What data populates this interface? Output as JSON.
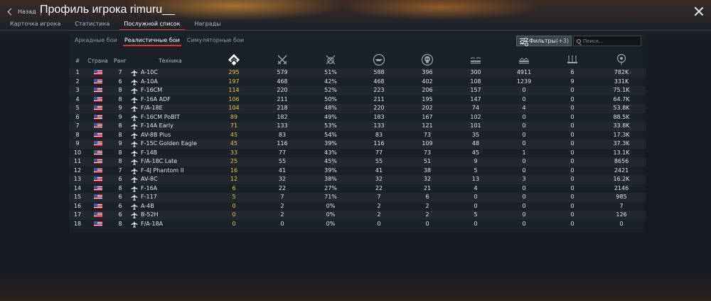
{
  "header": {
    "back_label": "Назад",
    "title": "Профиль игрока rimuru__"
  },
  "nav_tabs": [
    "Карточка игрока",
    "Статистика",
    "Послужной список",
    "Награды"
  ],
  "active_nav_tab": 2,
  "mode_tabs": [
    "Аркадные бои",
    "Реалистичные бои",
    "Симуляторные бои"
  ],
  "active_mode_tab": 1,
  "filter": {
    "label": "Фильтры",
    "count": "(+3)"
  },
  "search": {
    "placeholder": "Поиск..."
  },
  "colors": {
    "accent": "#d9322a",
    "highlight": "#e8c25a"
  },
  "table": {
    "headers": {
      "index": "#",
      "country": "Страна",
      "rank": "Ранг",
      "vehicle": "Техника"
    },
    "stat_icons": [
      "battles-icon",
      "air-kills-icon",
      "win-rate-icon",
      "air-targets-icon",
      "deaths-icon",
      "ground-targets-icon",
      "naval-targets-icon",
      "awards-icon",
      "score-icon"
    ],
    "rows": [
      {
        "n": "1",
        "rank": "7",
        "name": "A-10C",
        "v": [
          "295",
          "579",
          "51%",
          "588",
          "396",
          "300",
          "4911",
          "6",
          "782K"
        ]
      },
      {
        "n": "2",
        "rank": "6",
        "name": "A-10A",
        "v": [
          "197",
          "468",
          "42%",
          "468",
          "402",
          "108",
          "1239",
          "9",
          "331K"
        ]
      },
      {
        "n": "3",
        "rank": "8",
        "name": "F-16CM",
        "v": [
          "114",
          "220",
          "52%",
          "223",
          "206",
          "157",
          "0",
          "0",
          "75.1K"
        ]
      },
      {
        "n": "4",
        "rank": "8",
        "name": "F-16A ADF",
        "v": [
          "106",
          "211",
          "50%",
          "211",
          "195",
          "147",
          "0",
          "0",
          "64.7K"
        ]
      },
      {
        "n": "5",
        "rank": "9",
        "name": "F/A-18E",
        "v": [
          "104",
          "218",
          "48%",
          "220",
          "202",
          "74",
          "4",
          "0",
          "53.8K"
        ]
      },
      {
        "n": "6",
        "rank": "9",
        "name": "F-16CM PoBIT",
        "v": [
          "89",
          "182",
          "49%",
          "183",
          "167",
          "102",
          "0",
          "0",
          "88.5K"
        ]
      },
      {
        "n": "7",
        "rank": "8",
        "name": "F-14A Early",
        "v": [
          "71",
          "133",
          "53%",
          "133",
          "121",
          "101",
          "0",
          "0",
          "33.8K"
        ]
      },
      {
        "n": "8",
        "rank": "8",
        "name": "AV-8B Plus",
        "v": [
          "45",
          "83",
          "54%",
          "83",
          "73",
          "35",
          "0",
          "0",
          "17.3K"
        ]
      },
      {
        "n": "9",
        "rank": "9",
        "name": "F-15C Golden Eagle",
        "v": [
          "45",
          "116",
          "39%",
          "116",
          "109",
          "48",
          "0",
          "0",
          "37.3K"
        ]
      },
      {
        "n": "10",
        "rank": "8",
        "name": "F-14B",
        "v": [
          "33",
          "77",
          "43%",
          "77",
          "73",
          "45",
          "1",
          "0",
          "13.1K"
        ]
      },
      {
        "n": "11",
        "rank": "8",
        "name": "F/A-18C Late",
        "v": [
          "25",
          "55",
          "45%",
          "55",
          "51",
          "9",
          "0",
          "0",
          "8656"
        ]
      },
      {
        "n": "12",
        "rank": "7",
        "name": "F-4J Phantom II",
        "v": [
          "16",
          "41",
          "39%",
          "41",
          "38",
          "5",
          "0",
          "0",
          "2421"
        ]
      },
      {
        "n": "13",
        "rank": "6",
        "name": "AV-8C",
        "v": [
          "12",
          "32",
          "38%",
          "32",
          "32",
          "13",
          "3",
          "0",
          "16.2K"
        ]
      },
      {
        "n": "14",
        "rank": "8",
        "name": "F-16A",
        "v": [
          "6",
          "22",
          "27%",
          "22",
          "21",
          "4",
          "0",
          "0",
          "2146"
        ]
      },
      {
        "n": "15",
        "rank": "6",
        "name": "F-117",
        "v": [
          "5",
          "7",
          "71%",
          "7",
          "6",
          "0",
          "0",
          "0",
          "985"
        ]
      },
      {
        "n": "16",
        "rank": "6",
        "name": "A-4B",
        "v": [
          "0",
          "2",
          "0%",
          "2",
          "2",
          "0",
          "0",
          "0",
          "7"
        ]
      },
      {
        "n": "17",
        "rank": "6",
        "name": "B-52H",
        "v": [
          "0",
          "2",
          "0%",
          "2",
          "2",
          "5",
          "0",
          "0",
          "126"
        ]
      },
      {
        "n": "18",
        "rank": "8",
        "name": "F/A-18A",
        "v": [
          "0",
          "0",
          "0%",
          "0",
          "0",
          "0",
          "0",
          "0",
          "0"
        ]
      }
    ]
  }
}
